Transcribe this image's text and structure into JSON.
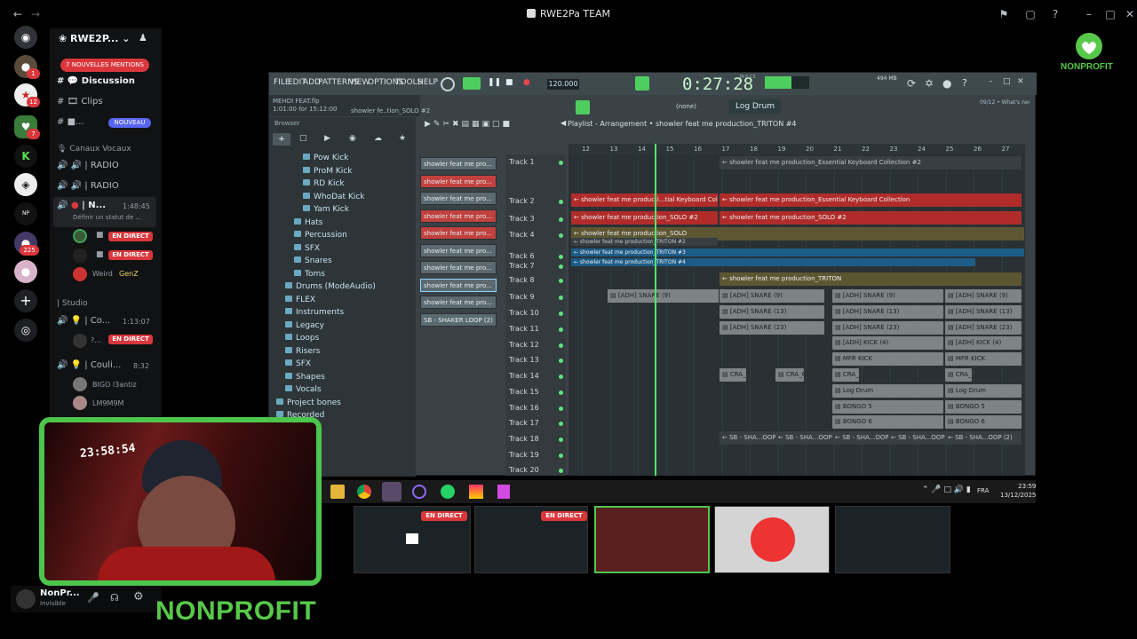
{
  "window": {
    "title": "RWE2Pa TEAM"
  },
  "server": {
    "name": "RWE2P...",
    "mentions_label": "7 NOUVELLES MENTIONS",
    "server_badges": [
      "1",
      "12",
      "7",
      "225"
    ]
  },
  "channels": {
    "discussion": "💬 Discussion",
    "clips": "🎞 Clips",
    "new_channel": "■...",
    "new_label": "NOUVEAU",
    "voice_category": "🎙 Canaux Vocaux",
    "radio1": "🔊 | RADIO",
    "radio2": "🔊 | RADIO",
    "active_voice": "| N...",
    "active_voice_time": "1:48:45",
    "status_hint": "Définir un statut de ...",
    "studio_category": "| Studio",
    "co_voice": "💡 | Co...",
    "co_time": "1:13:07",
    "co_user": "?...",
    "couli_voice": "💡 | Couli...",
    "couli_time": "8:32",
    "user_weird": "Weird",
    "user_weird_tag": "GenZ",
    "user_bigo": "BIGO l3antiz",
    "user_lm": "LM9M9M",
    "live_label": "EN DIRECT"
  },
  "user": {
    "name": "NonPr...",
    "status": "Invisible"
  },
  "fl": {
    "menu": [
      "FILE",
      "EDIT",
      "ADD",
      "PATTERNS",
      "VIEW",
      "OPTIONS",
      "TOOLS",
      "HELP"
    ],
    "hint_line1": "MEHDI FEAT.flp",
    "hint_line2": "1:01:00 for 15:12:00",
    "hint_line3": "showler fe..tion_SOLO #2",
    "tempo": "120.000",
    "time": "0:27:28",
    "time_small": "M:S:CS",
    "memory": "494 MB",
    "none_label": "(none)",
    "instrument": "Log Drum",
    "news": "09/12 • What's new i...",
    "browser_title": "Browser",
    "playlist_title": "Playlist - Arrangement • showler feat me production_TRITON #4",
    "browser_items": [
      {
        "label": "Pow Kick",
        "indent": 3
      },
      {
        "label": "ProM Kick",
        "indent": 3
      },
      {
        "label": "RD Kick",
        "indent": 3
      },
      {
        "label": "WhoDat Kick",
        "indent": 3
      },
      {
        "label": "Yam Kick",
        "indent": 3
      },
      {
        "label": "Hats",
        "indent": 2
      },
      {
        "label": "Percussion",
        "indent": 2
      },
      {
        "label": "SFX",
        "indent": 2
      },
      {
        "label": "Snares",
        "indent": 2
      },
      {
        "label": "Toms",
        "indent": 2
      },
      {
        "label": "Drums (ModeAudio)",
        "indent": 1
      },
      {
        "label": "FLEX",
        "indent": 1
      },
      {
        "label": "Instruments",
        "indent": 1
      },
      {
        "label": "Legacy",
        "indent": 1
      },
      {
        "label": "Loops",
        "indent": 1
      },
      {
        "label": "Risers",
        "indent": 1
      },
      {
        "label": "SFX",
        "indent": 1
      },
      {
        "label": "Shapes",
        "indent": 1
      },
      {
        "label": "Vocals",
        "indent": 1
      },
      {
        "label": "Project bones",
        "indent": 0
      },
      {
        "label": "Recorded",
        "indent": 0
      }
    ],
    "rack": [
      {
        "label": "showler feat me pro...",
        "style": ""
      },
      {
        "label": "showler feat me pro...",
        "style": "red"
      },
      {
        "label": "showler feat me pro...",
        "style": ""
      },
      {
        "label": "showler feat me pro...",
        "style": "red"
      },
      {
        "label": "showler feat me pro...",
        "style": "red"
      },
      {
        "label": "showler feat me pro...",
        "style": ""
      },
      {
        "label": "showler feat me pro...",
        "style": ""
      },
      {
        "label": "showler feat me pro...",
        "style": "sel"
      },
      {
        "label": "showler feat me pro...",
        "style": ""
      },
      {
        "label": "SB - SHAKER LOOP (2)",
        "style": ""
      }
    ],
    "ruler": [
      "12",
      "13",
      "14",
      "15",
      "16",
      "17",
      "18",
      "19",
      "20",
      "21",
      "22",
      "23",
      "24",
      "25",
      "26",
      "27"
    ],
    "tracks": [
      "Track 1",
      "Track 2",
      "Track 3",
      "Track 4",
      "Track 6",
      "Track 7",
      "Track 8",
      "Track 9",
      "Track 10",
      "Track 11",
      "Track 12",
      "Track 13",
      "Track 14",
      "Track 15",
      "Track 16",
      "Track 17",
      "Track 18",
      "Track 19",
      "Track 20"
    ],
    "clips": {
      "t1": "← showler feat me production_Essential Keyboard Collection #2",
      "t2a": "← showler feat me producti...tial Keyboard Collection",
      "t2b": "← showler feat me production_Essential Keyboard Collection",
      "t3a": "← showler feat me production_SOLO #2",
      "t3b": "← showler feat me production_SOLO #2",
      "t4": "← showler feat me production_SOLO",
      "t5": "← showler feat me production_TRITON #2",
      "t6": "← showler feat me production_TRITON #3",
      "t7": "← showler feat me production_TRITON #4",
      "t8": "← showler feat me production_TRITON",
      "snare9": "▤ [ADH] SNARE (9)",
      "snare13": "▤ [ADH] SNARE (13)",
      "snare23": "▤ [ADH] SNARE (23)",
      "kick4": "▤ [ADH] KICK (4)",
      "mfr": "▤ MFR KICK",
      "cra": "▤ CRA_6",
      "logdrum": "▤ Log Drum",
      "bongo5": "▤ BONGO 5",
      "bongo6": "▤ BONGO 6",
      "shaker": "← SB - SHA...OOP (2)"
    }
  },
  "taskbar": {
    "time": "23:59",
    "date": "13/12/2025",
    "lang": "FRA"
  },
  "webcam": {
    "clock": "23:58:54"
  },
  "branding": {
    "big": "NONPROFIT",
    "logo_text": "NONPROFIT"
  },
  "colors": {
    "accent_green": "#4cc64b",
    "discord_red": "#da373c",
    "fl_clip_red": "#b02c2a",
    "playhead": "#53e36f"
  }
}
